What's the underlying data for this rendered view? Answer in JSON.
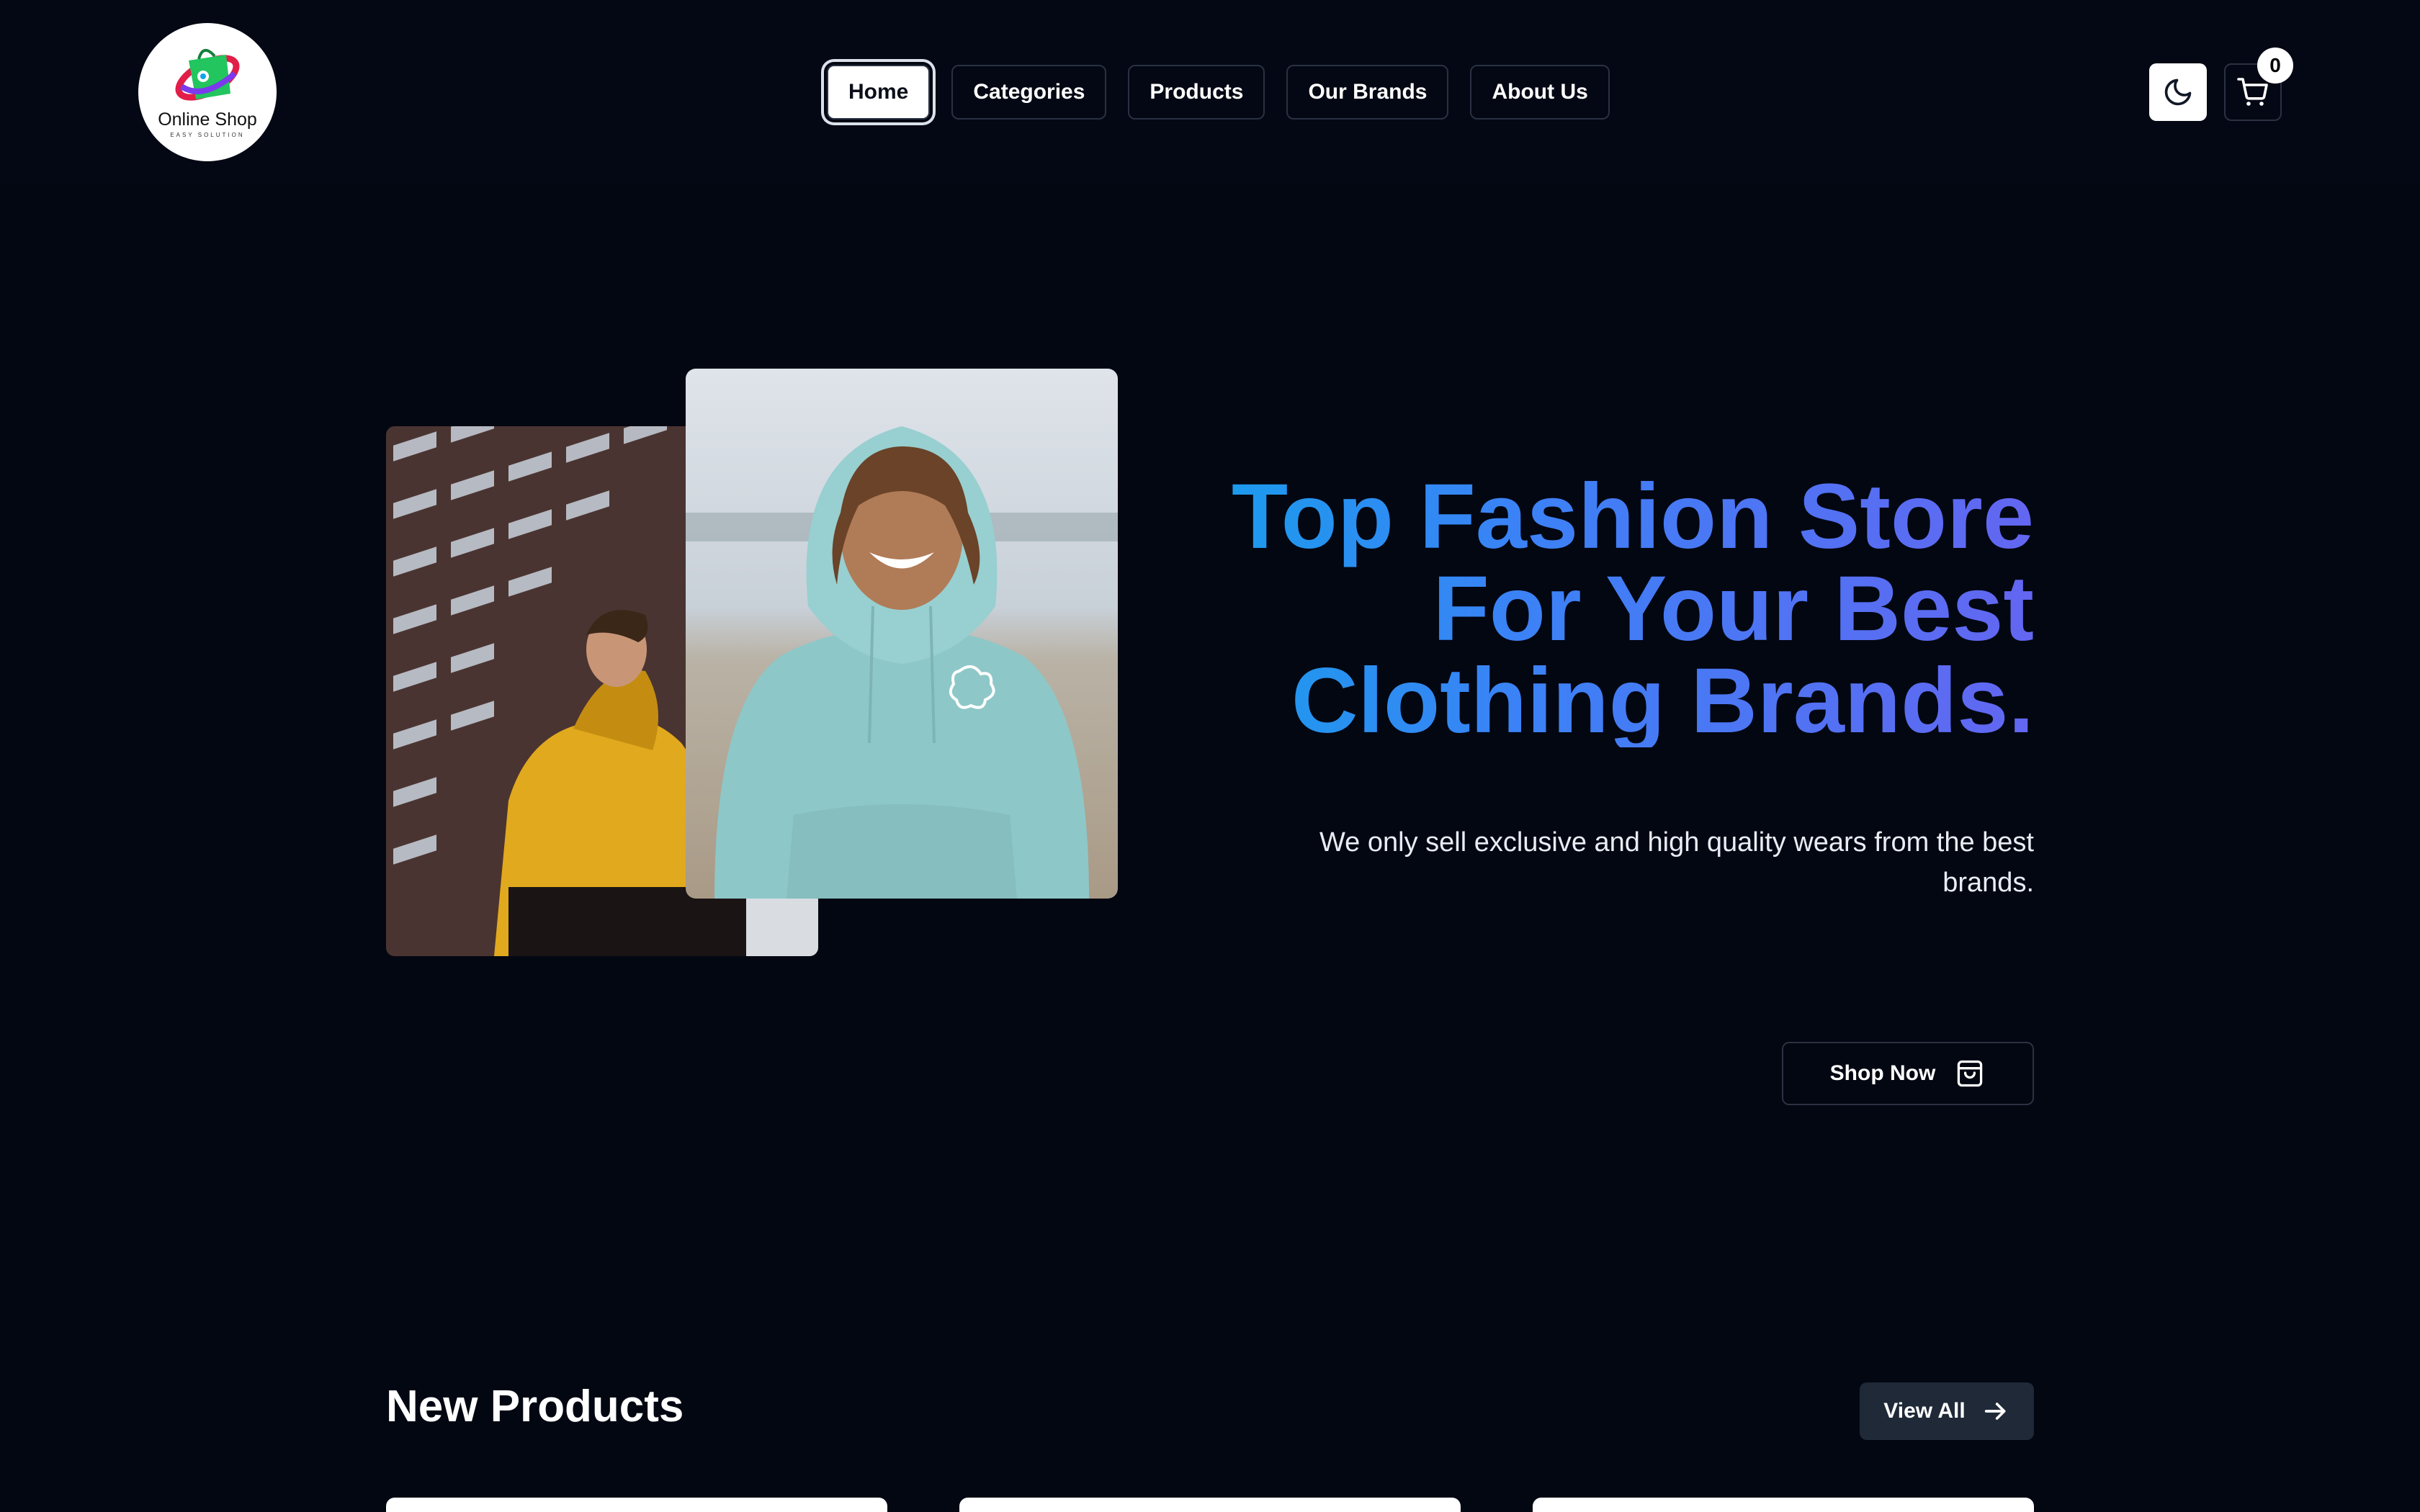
{
  "brand": {
    "logo_name": "Online Shop",
    "logo_tagline": "EASY SOLUTION",
    "colors": {
      "background": "#030712",
      "gradient_start": "#0ea5e9",
      "gradient_end": "#6366f1"
    }
  },
  "nav": {
    "items": [
      {
        "label": "Home",
        "active": true
      },
      {
        "label": "Categories"
      },
      {
        "label": "Products"
      },
      {
        "label": "Our Brands"
      },
      {
        "label": "About Us"
      }
    ]
  },
  "header_actions": {
    "theme_icon": "moon-icon",
    "cart_icon": "cart-icon",
    "cart_count": "0"
  },
  "hero": {
    "title_lines": [
      "Top Fashion Store",
      "For Your Best",
      "Clothing Brands."
    ],
    "subtitle": "We only sell exclusive and high quality wears from the best brands.",
    "cta_label": "Shop Now",
    "cta_icon": "shopping-bag-icon"
  },
  "new_products": {
    "title": "New Products",
    "view_all_label": "View All",
    "view_all_icon": "arrow-right-icon"
  }
}
